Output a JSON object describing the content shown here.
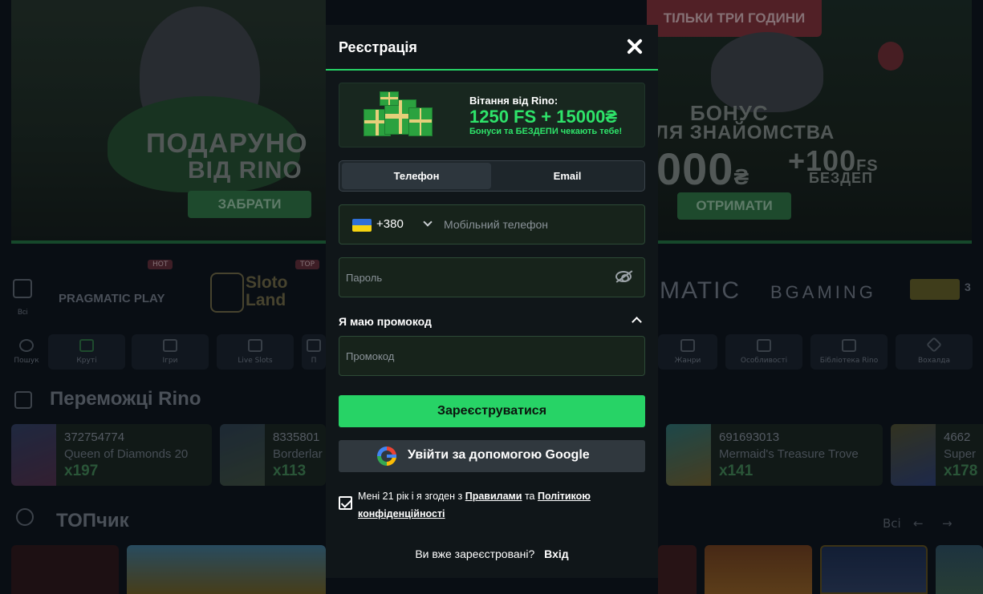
{
  "background": {
    "banner_left": {
      "title_line1": "ПОДАРУНО",
      "title_line2": "ВІД RINO",
      "button": "ЗАБРАТИ"
    },
    "banner_right": {
      "top_tag": "ТІЛЬКИ ТРИ ГОДИНИ",
      "line1": "БОНУС",
      "line2": "ЛЯ ЗНАЙОМСТВА",
      "amount": "000",
      "currency": "₴",
      "plus": "+100",
      "fs": "FS",
      "bezdep": "БЕЗДЕП",
      "button": "ОТРИМАТИ"
    },
    "all_label": "Всі",
    "providers": [
      {
        "name": "PRAGMATIC PLAY",
        "badge": "HOT"
      },
      {
        "name": "Sloto Land",
        "badge": "TOP"
      },
      {
        "name": "MATIC",
        "badge": ""
      },
      {
        "name": "BGAMING",
        "badge": ""
      },
      {
        "name": "3",
        "badge": ""
      }
    ],
    "categories": [
      {
        "label": "Пошук"
      },
      {
        "label": "Круті"
      },
      {
        "label": "Ігри"
      },
      {
        "label": "Live Slots"
      },
      {
        "label": "П"
      },
      {
        "label": "Жанри"
      },
      {
        "label": "Особливості"
      },
      {
        "label": "Бібліотека Rino"
      },
      {
        "label": "Вохалда"
      }
    ],
    "winners_title": "Переможці Rino",
    "winners": [
      {
        "id": "372754774",
        "game": "Queen of Diamonds 20",
        "mult": "x197"
      },
      {
        "id": "8335801",
        "game": "Borderlar",
        "mult": "x113"
      },
      {
        "id": "691693013",
        "game": "Mermaid's Treasure Trove",
        "mult": "x141"
      },
      {
        "id": "4662",
        "game": "Super",
        "mult": "x178"
      }
    ],
    "top_title": "ТОПчик",
    "top_all": "Всі",
    "top_prev": "←",
    "top_next": "→"
  },
  "modal": {
    "title": "Реєстрація",
    "promo": {
      "line1": "Вітання від Rino:",
      "line2": "1250 FS + 15000₴",
      "line3": "Бонуси та БЕЗДЕПИ чекають тебе!"
    },
    "tabs": [
      {
        "label": "Телефон"
      },
      {
        "label": "Email"
      }
    ],
    "phone": {
      "code": "+380",
      "placeholder": "Мобільний телефон"
    },
    "password": {
      "placeholder": "Пароль"
    },
    "promo_toggle": "Я маю промокод",
    "promocode": {
      "placeholder": "Промокод"
    },
    "register_button": "Зареєструватися",
    "google_button": "Увійти за допомогою Google",
    "consent": {
      "prefix": "Мені 21 рік і я згоден з ",
      "rules": "Правилами",
      "and": " та ",
      "privacy": "Політикою конфіденційності"
    },
    "login": {
      "question": "Ви вже зареєстровані?",
      "link": "Вхід"
    }
  },
  "colors": {
    "accent": "#27d366",
    "modal_bg": "#101619",
    "page_bg": "#0b1117"
  }
}
